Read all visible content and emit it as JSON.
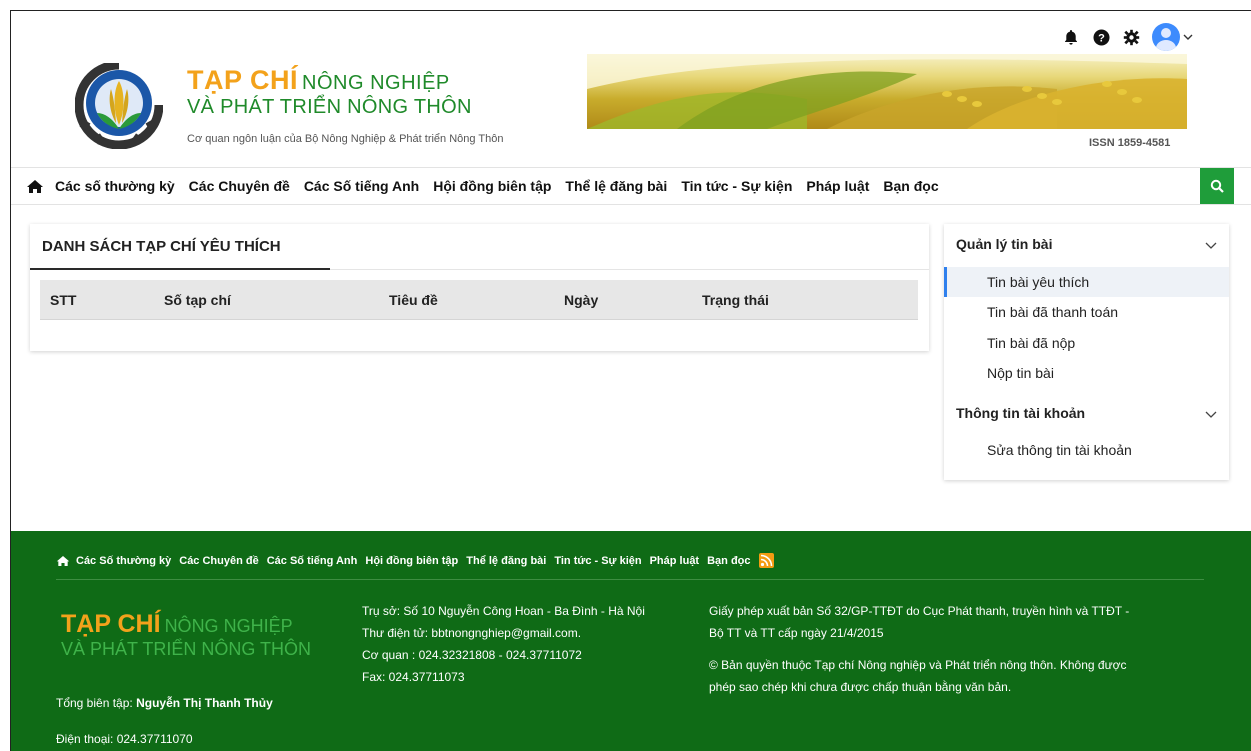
{
  "utility": {
    "bell": "bell-icon",
    "help": "help-icon",
    "settings": "gear-icon",
    "avatar": "user-avatar",
    "caret": "chevron-down-icon"
  },
  "header": {
    "brand_tap_chi": "TẠP CHÍ",
    "brand_nong_nghiep": "NÔNG NGHIỆP",
    "brand_line2": "VÀ PHÁT TRIỂN NÔNG THÔN",
    "tagline": "Cơ quan ngôn luận của Bộ Nông Nghiệp & Phát triển Nông Thôn",
    "issn": "ISSN 1859-4581"
  },
  "nav": {
    "items": [
      "Các số thường kỳ",
      "Các Chuyên đề",
      "Các Số tiếng Anh",
      "Hội đồng biên tập",
      "Thể lệ đăng bài",
      "Tin tức - Sự kiện",
      "Pháp luật",
      "Bạn đọc"
    ]
  },
  "main": {
    "title": "DANH SÁCH TẠP CHÍ YÊU THÍCH",
    "columns": [
      "STT",
      "Số tạp chí",
      "Tiêu đề",
      "Ngày",
      "Trạng thái"
    ]
  },
  "sidebar": {
    "section1": "Quản lý tin bài",
    "items1": [
      "Tin bài yêu thích",
      "Tin bài đã thanh toán",
      "Tin bài đã nộp",
      "Nộp tin bài"
    ],
    "section2": "Thông tin tài khoản",
    "items2": [
      "Sửa thông tin tài khoản"
    ]
  },
  "footer": {
    "nav": [
      "Các Số thường kỳ",
      "Các Chuyên đề",
      "Các Số tiếng Anh",
      "Hội đồng biên tập",
      "Thể lệ đăng bài",
      "Tin tức - Sự kiện",
      "Pháp luật",
      "Bạn đọc"
    ],
    "logo_tap_chi": "TẠP CHÍ",
    "logo_nong_nghiep": "NÔNG NGHIỆP",
    "logo_line2": "VÀ PHÁT TRIỂN NÔNG THÔN",
    "editor_label": "Tổng biên tập:",
    "editor_name": "Nguyễn Thị Thanh Thủy",
    "phone": "Điện thoại: 024.37711070",
    "contact": [
      "Trụ sở: Số 10 Nguyễn Công Hoan - Ba Đình - Hà Nội",
      "Thư điện tử: bbtnongnghiep@gmail.com.",
      "Cơ quan : 024.32321808 - 024.37711072",
      "Fax: 024.37711073"
    ],
    "license_1": "Giấy phép xuất bản Số 32/GP-TTĐT do Cục Phát thanh, truyền hình và TTĐT -",
    "license_2": "Bộ TT và TT cấp ngày 21/4/2015",
    "copyright_1": "© Bản quyền thuộc Tạp chí Nông nghiệp và Phát triển nông thôn. Không được",
    "copyright_2": "phép sao chép khi chưa được chấp thuận bằng văn bản."
  },
  "colors": {
    "brand_orange": "#f3a21b",
    "brand_green": "#1f8a2a",
    "footer_bg": "#0f6b16",
    "search_bg": "#1f9d3a",
    "active_border": "#2f80ed"
  }
}
